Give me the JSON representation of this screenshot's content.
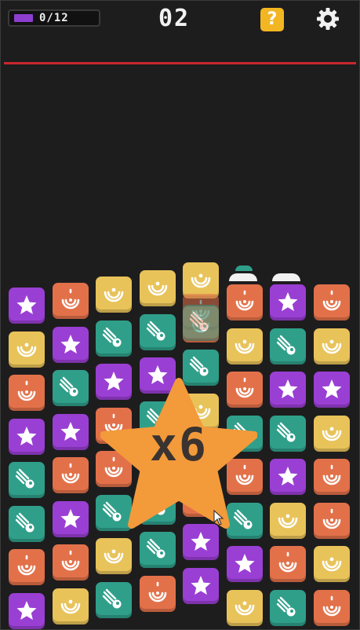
{
  "hud": {
    "progress_label": "0/12",
    "progress_fraction": 0.0,
    "score": "02",
    "help_label": "?",
    "icons": {
      "help": "question-mark-icon",
      "settings": "gear-icon"
    }
  },
  "combo": {
    "label": "x6"
  },
  "colors": {
    "orange": "#e2714a",
    "purple": "#9a3fd4",
    "yellow": "#e8c35a",
    "teal": "#2f9f8a",
    "danger_line": "#c7272d",
    "combo_star": "#f39a3b",
    "progress_fill": "#8d3ecf"
  },
  "board": {
    "columns": 8,
    "symbols": {
      "O": "spiral-icon",
      "S": "star-icon",
      "Y": "moon-icon",
      "T": "comet-icon"
    }
  }
}
